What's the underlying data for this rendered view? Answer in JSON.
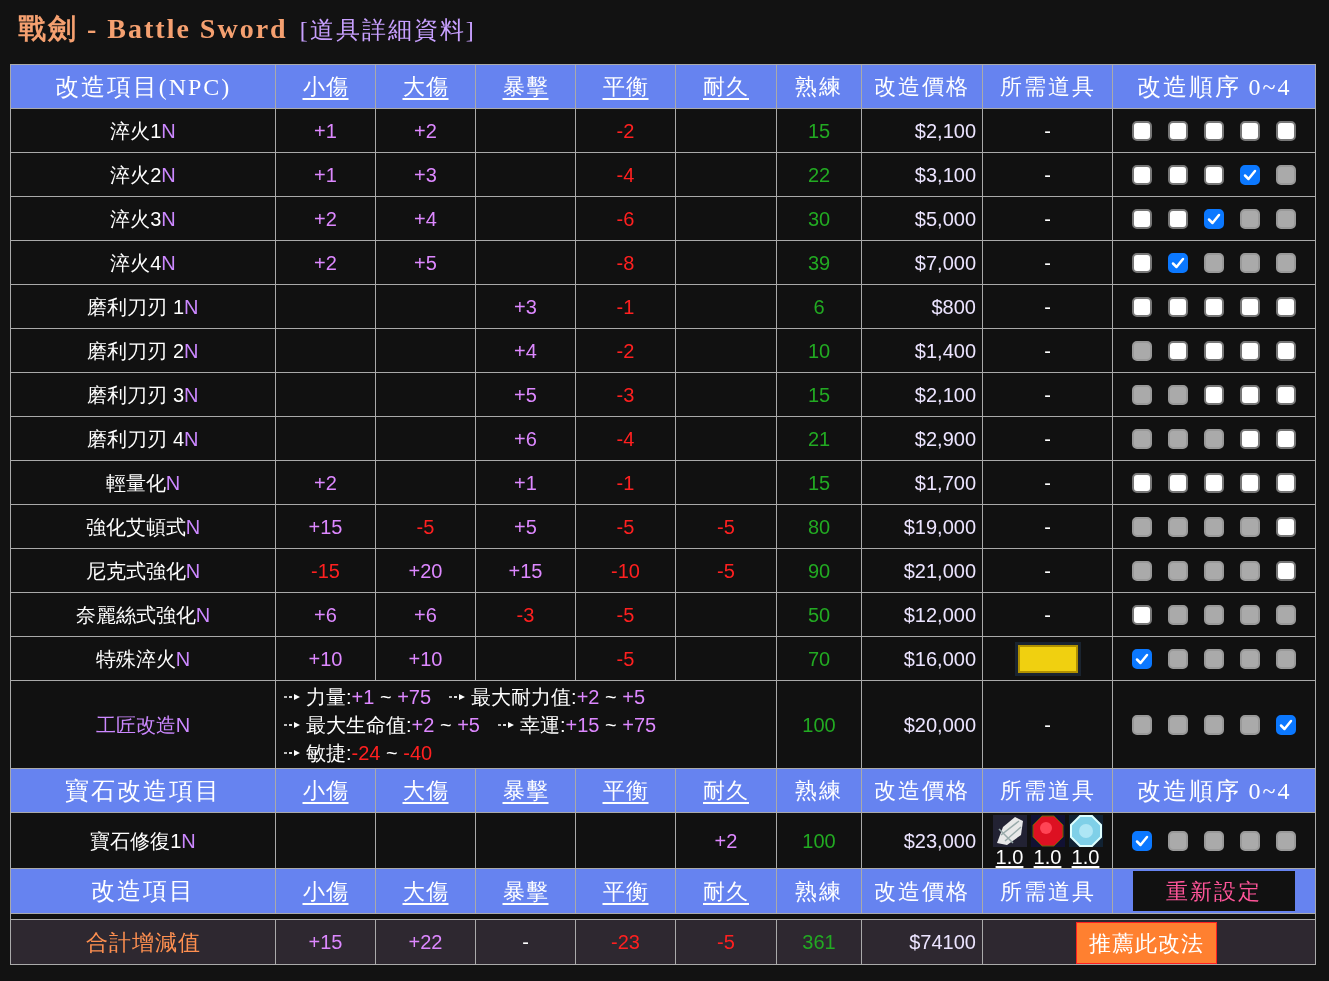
{
  "title": {
    "name": "戰劍 - Battle Sword",
    "subtitle": "[道具詳細資料]"
  },
  "npc_header": [
    {
      "text": "改造項目(NPC)",
      "link": false
    },
    {
      "text": "小傷",
      "link": true
    },
    {
      "text": "大傷",
      "link": true
    },
    {
      "text": "暴擊",
      "link": true
    },
    {
      "text": "平衡",
      "link": true
    },
    {
      "text": "耐久",
      "link": true
    },
    {
      "text": "熟練",
      "link": false
    },
    {
      "text": "改造價格",
      "link": false
    },
    {
      "text": "所需道具",
      "link": false
    },
    {
      "text": "改造順序 0~4",
      "link": false
    }
  ],
  "npc_rows": [
    {
      "kind": "stats",
      "name": "淬火1",
      "suffix": "N",
      "stats": {
        "small_damage": {
          "text": "+1",
          "color": "#dd88ff"
        },
        "large_damage": {
          "text": "+2",
          "color": "#dd88ff"
        },
        "balance": {
          "text": "-2",
          "color": "#ff2020"
        }
      },
      "proficiency": "15",
      "price": "$2,100",
      "items": [
        {
          "kind": "dash",
          "text": "-"
        }
      ],
      "order": [
        {
          "checked": false,
          "disabled": false
        },
        {
          "checked": false,
          "disabled": false
        },
        {
          "checked": false,
          "disabled": false
        },
        {
          "checked": false,
          "disabled": false
        },
        {
          "checked": false,
          "disabled": false
        }
      ]
    },
    {
      "kind": "stats",
      "name": "淬火2",
      "suffix": "N",
      "stats": {
        "small_damage": {
          "text": "+1",
          "color": "#dd88ff"
        },
        "large_damage": {
          "text": "+3",
          "color": "#dd88ff"
        },
        "balance": {
          "text": "-4",
          "color": "#ff2020"
        }
      },
      "proficiency": "22",
      "price": "$3,100",
      "items": [
        {
          "kind": "dash",
          "text": "-"
        }
      ],
      "order": [
        {
          "checked": false,
          "disabled": false
        },
        {
          "checked": false,
          "disabled": false
        },
        {
          "checked": false,
          "disabled": false
        },
        {
          "checked": true,
          "disabled": false
        },
        {
          "checked": false,
          "disabled": true
        }
      ]
    },
    {
      "kind": "stats",
      "name": "淬火3",
      "suffix": "N",
      "stats": {
        "small_damage": {
          "text": "+2",
          "color": "#dd88ff"
        },
        "large_damage": {
          "text": "+4",
          "color": "#dd88ff"
        },
        "balance": {
          "text": "-6",
          "color": "#ff2020"
        }
      },
      "proficiency": "30",
      "price": "$5,000",
      "items": [
        {
          "kind": "dash",
          "text": "-"
        }
      ],
      "order": [
        {
          "checked": false,
          "disabled": false
        },
        {
          "checked": false,
          "disabled": false
        },
        {
          "checked": true,
          "disabled": false
        },
        {
          "checked": false,
          "disabled": true
        },
        {
          "checked": false,
          "disabled": true
        }
      ]
    },
    {
      "kind": "stats",
      "name": "淬火4",
      "suffix": "N",
      "stats": {
        "small_damage": {
          "text": "+2",
          "color": "#dd88ff"
        },
        "large_damage": {
          "text": "+5",
          "color": "#dd88ff"
        },
        "balance": {
          "text": "-8",
          "color": "#ff2020"
        }
      },
      "proficiency": "39",
      "price": "$7,000",
      "items": [
        {
          "kind": "dash",
          "text": "-"
        }
      ],
      "order": [
        {
          "checked": false,
          "disabled": false
        },
        {
          "checked": true,
          "disabled": false
        },
        {
          "checked": false,
          "disabled": true
        },
        {
          "checked": false,
          "disabled": true
        },
        {
          "checked": false,
          "disabled": true
        }
      ]
    },
    {
      "kind": "stats",
      "name": "磨利刀刃 1",
      "suffix": "N",
      "stats": {
        "critical": {
          "text": "+3",
          "color": "#dd88ff"
        },
        "balance": {
          "text": "-1",
          "color": "#ff2020"
        }
      },
      "proficiency": "6",
      "price": "$800",
      "items": [
        {
          "kind": "dash",
          "text": "-"
        }
      ],
      "order": [
        {
          "checked": false,
          "disabled": false
        },
        {
          "checked": false,
          "disabled": false
        },
        {
          "checked": false,
          "disabled": false
        },
        {
          "checked": false,
          "disabled": false
        },
        {
          "checked": false,
          "disabled": false
        }
      ]
    },
    {
      "kind": "stats",
      "name": "磨利刀刃 2",
      "suffix": "N",
      "stats": {
        "critical": {
          "text": "+4",
          "color": "#dd88ff"
        },
        "balance": {
          "text": "-2",
          "color": "#ff2020"
        }
      },
      "proficiency": "10",
      "price": "$1,400",
      "items": [
        {
          "kind": "dash",
          "text": "-"
        }
      ],
      "order": [
        {
          "checked": false,
          "disabled": true
        },
        {
          "checked": false,
          "disabled": false
        },
        {
          "checked": false,
          "disabled": false
        },
        {
          "checked": false,
          "disabled": false
        },
        {
          "checked": false,
          "disabled": false
        }
      ]
    },
    {
      "kind": "stats",
      "name": "磨利刀刃 3",
      "suffix": "N",
      "stats": {
        "critical": {
          "text": "+5",
          "color": "#dd88ff"
        },
        "balance": {
          "text": "-3",
          "color": "#ff2020"
        }
      },
      "proficiency": "15",
      "price": "$2,100",
      "items": [
        {
          "kind": "dash",
          "text": "-"
        }
      ],
      "order": [
        {
          "checked": false,
          "disabled": true
        },
        {
          "checked": false,
          "disabled": true
        },
        {
          "checked": false,
          "disabled": false
        },
        {
          "checked": false,
          "disabled": false
        },
        {
          "checked": false,
          "disabled": false
        }
      ]
    },
    {
      "kind": "stats",
      "name": "磨利刀刃 4",
      "suffix": "N",
      "stats": {
        "critical": {
          "text": "+6",
          "color": "#dd88ff"
        },
        "balance": {
          "text": "-4",
          "color": "#ff2020"
        }
      },
      "proficiency": "21",
      "price": "$2,900",
      "items": [
        {
          "kind": "dash",
          "text": "-"
        }
      ],
      "order": [
        {
          "checked": false,
          "disabled": true
        },
        {
          "checked": false,
          "disabled": true
        },
        {
          "checked": false,
          "disabled": true
        },
        {
          "checked": false,
          "disabled": false
        },
        {
          "checked": false,
          "disabled": false
        }
      ]
    },
    {
      "kind": "stats",
      "name": "輕量化",
      "suffix": "N",
      "stats": {
        "small_damage": {
          "text": "+2",
          "color": "#dd88ff"
        },
        "critical": {
          "text": "+1",
          "color": "#dd88ff"
        },
        "balance": {
          "text": "-1",
          "color": "#ff2020"
        }
      },
      "proficiency": "15",
      "price": "$1,700",
      "items": [
        {
          "kind": "dash",
          "text": "-"
        }
      ],
      "order": [
        {
          "checked": false,
          "disabled": false
        },
        {
          "checked": false,
          "disabled": false
        },
        {
          "checked": false,
          "disabled": false
        },
        {
          "checked": false,
          "disabled": false
        },
        {
          "checked": false,
          "disabled": false
        }
      ]
    },
    {
      "kind": "stats",
      "name": "強化艾頓式",
      "suffix": "N",
      "stats": {
        "small_damage": {
          "text": "+15",
          "color": "#dd88ff"
        },
        "large_damage": {
          "text": "-5",
          "color": "#ff2020"
        },
        "critical": {
          "text": "+5",
          "color": "#dd88ff"
        },
        "balance": {
          "text": "-5",
          "color": "#ff2020"
        },
        "durability": {
          "text": "-5",
          "color": "#ff2020"
        }
      },
      "proficiency": "80",
      "price": "$19,000",
      "items": [
        {
          "kind": "dash",
          "text": "-"
        }
      ],
      "order": [
        {
          "checked": false,
          "disabled": true
        },
        {
          "checked": false,
          "disabled": true
        },
        {
          "checked": false,
          "disabled": true
        },
        {
          "checked": false,
          "disabled": true
        },
        {
          "checked": false,
          "disabled": false
        }
      ]
    },
    {
      "kind": "stats",
      "name": "尼克式強化",
      "suffix": "N",
      "stats": {
        "small_damage": {
          "text": "-15",
          "color": "#ff2020"
        },
        "large_damage": {
          "text": "+20",
          "color": "#dd88ff"
        },
        "critical": {
          "text": "+15",
          "color": "#dd88ff"
        },
        "balance": {
          "text": "-10",
          "color": "#ff2020"
        },
        "durability": {
          "text": "-5",
          "color": "#ff2020"
        }
      },
      "proficiency": "90",
      "price": "$21,000",
      "items": [
        {
          "kind": "dash",
          "text": "-"
        }
      ],
      "order": [
        {
          "checked": false,
          "disabled": true
        },
        {
          "checked": false,
          "disabled": true
        },
        {
          "checked": false,
          "disabled": true
        },
        {
          "checked": false,
          "disabled": true
        },
        {
          "checked": false,
          "disabled": false
        }
      ]
    },
    {
      "kind": "stats",
      "name": "奈麗絲式強化",
      "suffix": "N",
      "stats": {
        "small_damage": {
          "text": "+6",
          "color": "#dd88ff"
        },
        "large_damage": {
          "text": "+6",
          "color": "#dd88ff"
        },
        "critical": {
          "text": "-3",
          "color": "#ff2020"
        },
        "balance": {
          "text": "-5",
          "color": "#ff2020"
        }
      },
      "proficiency": "50",
      "price": "$12,000",
      "items": [
        {
          "kind": "dash",
          "text": "-"
        }
      ],
      "order": [
        {
          "checked": false,
          "disabled": false
        },
        {
          "checked": false,
          "disabled": true
        },
        {
          "checked": false,
          "disabled": true
        },
        {
          "checked": false,
          "disabled": true
        },
        {
          "checked": false,
          "disabled": true
        }
      ]
    },
    {
      "kind": "stats",
      "name": "特殊淬火",
      "suffix": "N",
      "stats": {
        "small_damage": {
          "text": "+10",
          "color": "#dd88ff"
        },
        "large_damage": {
          "text": "+10",
          "color": "#dd88ff"
        },
        "balance": {
          "text": "-5",
          "color": "#ff2020"
        }
      },
      "proficiency": "70",
      "price": "$16,000",
      "items": [
        {
          "kind": "ingot"
        }
      ],
      "order": [
        {
          "checked": true,
          "disabled": false
        },
        {
          "checked": false,
          "disabled": true
        },
        {
          "checked": false,
          "disabled": true
        },
        {
          "checked": false,
          "disabled": true
        },
        {
          "checked": false,
          "disabled": true
        }
      ]
    },
    {
      "kind": "ranges",
      "name": "工匠改造",
      "suffix": "N",
      "lines": [
        [
          {
            "label": "力量:",
            "low": "+1",
            "tilde": "~",
            "high": "+75",
            "color": "#dd88ff"
          },
          {
            "label": "最大耐力值:",
            "low": "+2",
            "tilde": "~",
            "high": "+5",
            "color": "#dd88ff"
          }
        ],
        [
          {
            "label": "最大生命值:",
            "low": "+2",
            "tilde": "~",
            "high": "+5",
            "color": "#dd88ff"
          },
          {
            "label": "幸運:",
            "low": "+15",
            "tilde": "~",
            "high": "+75",
            "color": "#dd88ff"
          }
        ],
        [
          {
            "label": "敏捷:",
            "low": "-24",
            "tilde": "~",
            "high": "-40",
            "color": "#ff2020"
          }
        ]
      ],
      "proficiency": "100",
      "price": "$20,000",
      "items": [
        {
          "kind": "dash",
          "text": "-"
        }
      ],
      "order": [
        {
          "checked": false,
          "disabled": true
        },
        {
          "checked": false,
          "disabled": true
        },
        {
          "checked": false,
          "disabled": true
        },
        {
          "checked": false,
          "disabled": true
        },
        {
          "checked": true,
          "disabled": false
        }
      ]
    }
  ],
  "gem_header": [
    {
      "text": "寶石改造項目",
      "link": false
    },
    {
      "text": "小傷",
      "link": true
    },
    {
      "text": "大傷",
      "link": true
    },
    {
      "text": "暴擊",
      "link": true
    },
    {
      "text": "平衡",
      "link": true
    },
    {
      "text": "耐久",
      "link": true
    },
    {
      "text": "熟練",
      "link": false
    },
    {
      "text": "改造價格",
      "link": false
    },
    {
      "text": "所需道具",
      "link": false
    },
    {
      "text": "改造順序 0~4",
      "link": false
    }
  ],
  "gem_rows": [
    {
      "kind": "stats",
      "name": "寶石修復1",
      "suffix": "N",
      "stats": {
        "durability": {
          "text": "+2",
          "color": "#dd88ff"
        }
      },
      "proficiency": "100",
      "price": "$23,000",
      "items": [
        {
          "kind": "white-gem",
          "amount": "1.0"
        },
        {
          "kind": "red-gem",
          "amount": "1.0"
        },
        {
          "kind": "blue-gem",
          "amount": "1.0"
        }
      ],
      "order": [
        {
          "checked": true,
          "disabled": false
        },
        {
          "checked": false,
          "disabled": true
        },
        {
          "checked": false,
          "disabled": true
        },
        {
          "checked": false,
          "disabled": true
        },
        {
          "checked": false,
          "disabled": true
        }
      ]
    }
  ],
  "footer_header": [
    {
      "text": "改造項目",
      "link": false
    },
    {
      "text": "小傷",
      "link": true
    },
    {
      "text": "大傷",
      "link": true
    },
    {
      "text": "暴擊",
      "link": true
    },
    {
      "text": "平衡",
      "link": true
    },
    {
      "text": "耐久",
      "link": true
    },
    {
      "text": "熟練",
      "link": false
    },
    {
      "text": "改造價格",
      "link": false
    },
    {
      "text": "所需道具",
      "link": false
    }
  ],
  "reset_button": "重新設定",
  "totals": {
    "label": "合計增減值",
    "values": [
      {
        "text": "+15",
        "color": "#dd88ff"
      },
      {
        "text": "+22",
        "color": "#dd88ff"
      },
      {
        "text": "-",
        "color": "#ffffff"
      },
      {
        "text": "-23",
        "color": "#ff2020"
      },
      {
        "text": "-5",
        "color": "#ff2020"
      }
    ],
    "proficiency": "361",
    "price": "$74100",
    "recommend_button": "推薦此改法"
  }
}
